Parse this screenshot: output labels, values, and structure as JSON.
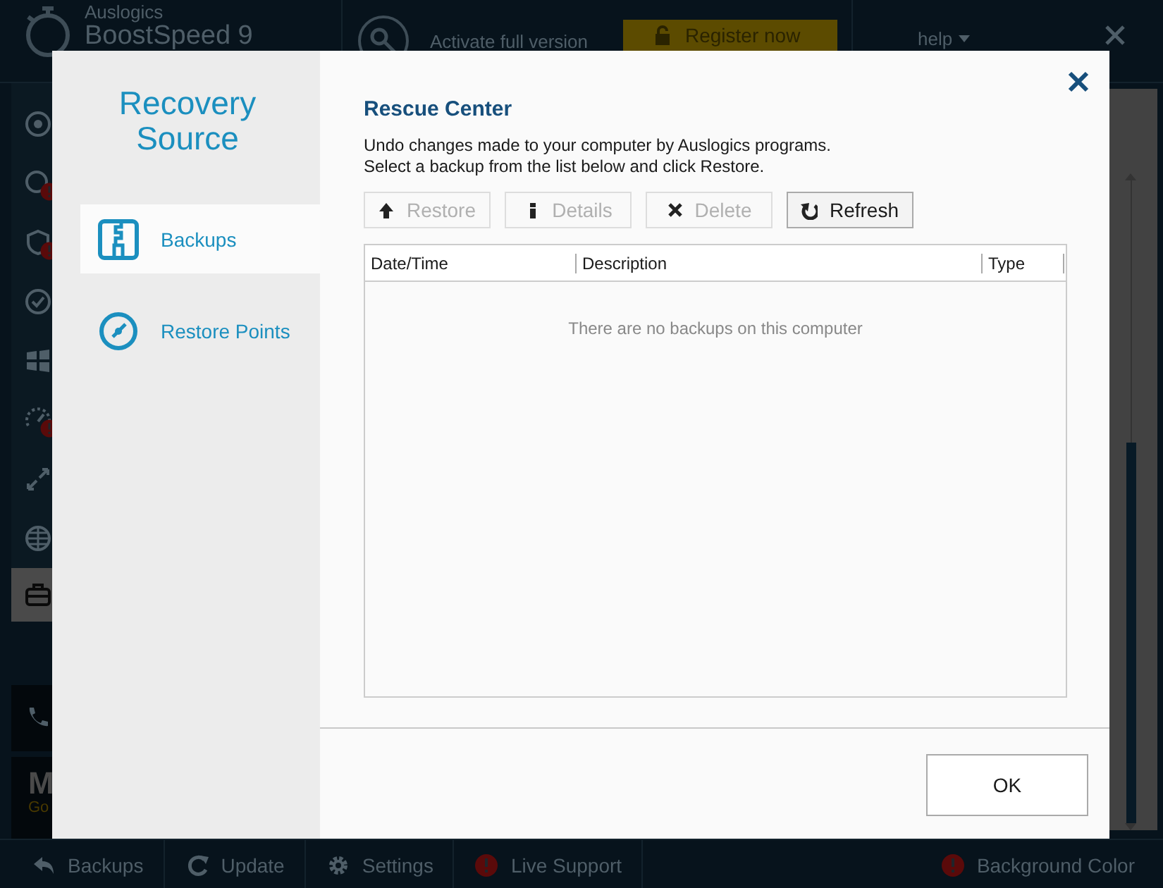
{
  "app": {
    "brand": "Auslogics",
    "product": "BoostSpeed 9",
    "activate": "Activate full version",
    "register": "Register now",
    "help": "help",
    "nav_items": [
      {
        "kind": "target",
        "alert": false,
        "selected": false
      },
      {
        "kind": "search",
        "alert": true,
        "selected": false
      },
      {
        "kind": "shield",
        "alert": true,
        "selected": false
      },
      {
        "kind": "check",
        "alert": false,
        "selected": false
      },
      {
        "kind": "windows",
        "alert": false,
        "selected": false
      },
      {
        "kind": "speed",
        "alert": true,
        "selected": false
      },
      {
        "kind": "arrows",
        "alert": false,
        "selected": false
      },
      {
        "kind": "globe",
        "alert": false,
        "selected": false
      },
      {
        "kind": "briefcase",
        "alert": false,
        "selected": true
      }
    ],
    "promo": {
      "title": "M",
      "subtitle": "Go"
    },
    "bottom_bar": [
      {
        "label": "Backups",
        "kind": "back"
      },
      {
        "label": "Update",
        "kind": "update"
      },
      {
        "label": "Settings",
        "kind": "gear"
      },
      {
        "label": "Live Support",
        "kind": "alert"
      }
    ],
    "bottom_right": {
      "label": "Background Color",
      "kind": "alert"
    }
  },
  "dialog": {
    "title": "Recovery Source",
    "sources": [
      {
        "label": "Backups",
        "kind": "backups",
        "selected": true
      },
      {
        "label": "Restore Points",
        "kind": "points",
        "selected": false
      }
    ],
    "heading": "Rescue Center",
    "description": [
      "Undo changes made to your computer by Auslogics programs.",
      "Select a backup from the list below and click Restore."
    ],
    "toolbar": [
      {
        "label": "Restore",
        "kind": "up",
        "disabled": true
      },
      {
        "label": "Details",
        "kind": "info",
        "disabled": true
      },
      {
        "label": "Delete",
        "kind": "delete",
        "disabled": true
      },
      {
        "label": "Refresh",
        "kind": "refresh",
        "disabled": false
      }
    ],
    "table": {
      "columns": [
        "Date/Time",
        "Description",
        "Type"
      ],
      "empty_message": "There are no backups on this computer"
    },
    "ok": "OK"
  }
}
